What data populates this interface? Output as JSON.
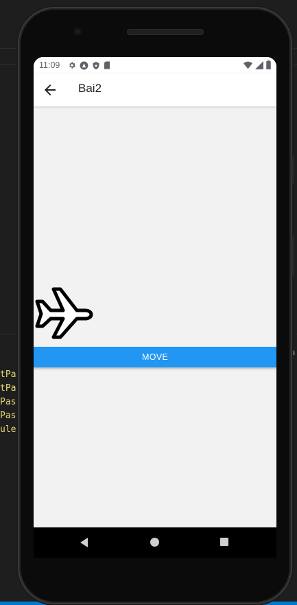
{
  "ide": {
    "code_lines": [
      "tPa",
      "tPa",
      "Pas",
      "Pas",
      "ule"
    ],
    "right_fragment": "n"
  },
  "status_bar": {
    "time": "11:09",
    "icons": [
      "gear-icon",
      "android-triangle-icon",
      "shield-icon",
      "sd-card-icon",
      "wifi-icon",
      "signal-icon",
      "battery-icon"
    ]
  },
  "app_bar": {
    "title": "Bai2",
    "back_icon": "arrow-back-icon"
  },
  "content": {
    "plane_icon": "airplane-icon",
    "move_button_label": "MOVE"
  },
  "colors": {
    "accent": "#2196f3",
    "screen_bg": "#f2f2f2",
    "app_bar_bg": "#ffffff",
    "ide_bg": "#1e1e1e",
    "ide_text": "#e6db74"
  },
  "nav_bar": {
    "buttons": [
      "back-triangle-icon",
      "home-circle-icon",
      "recents-square-icon"
    ]
  }
}
